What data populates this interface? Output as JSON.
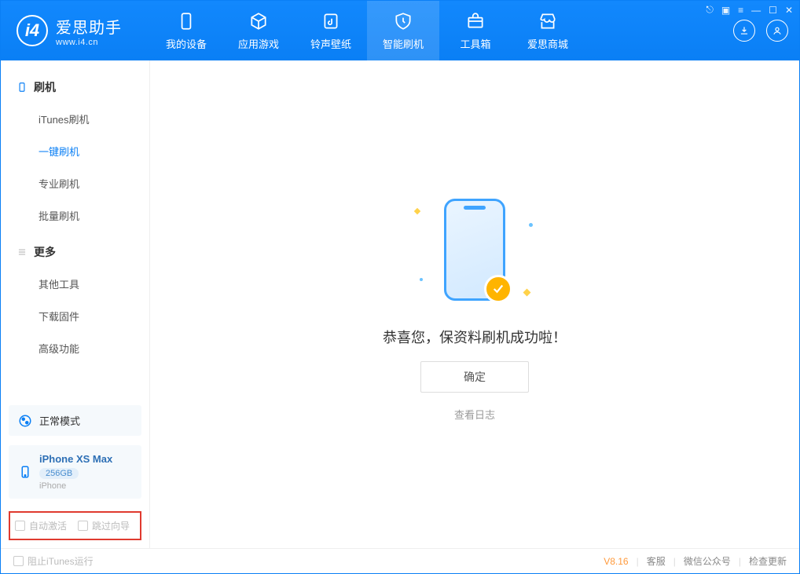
{
  "app": {
    "name_zh": "爱思助手",
    "name_en": "www.i4.cn",
    "version": "V8.16"
  },
  "tabs": [
    {
      "label": "我的设备"
    },
    {
      "label": "应用游戏"
    },
    {
      "label": "铃声壁纸"
    },
    {
      "label": "智能刷机"
    },
    {
      "label": "工具箱"
    },
    {
      "label": "爱思商城"
    }
  ],
  "sidebar": {
    "group1_title": "刷机",
    "group1_items": [
      "iTunes刷机",
      "一键刷机",
      "专业刷机",
      "批量刷机"
    ],
    "group2_title": "更多",
    "group2_items": [
      "其他工具",
      "下载固件",
      "高级功能"
    ]
  },
  "device": {
    "mode": "正常模式",
    "name": "iPhone XS Max",
    "capacity": "256GB",
    "type": "iPhone"
  },
  "options": {
    "auto_activate": "自动激活",
    "skip_guide": "跳过向导"
  },
  "main": {
    "success_msg": "恭喜您，保资料刷机成功啦！",
    "ok_btn": "确定",
    "log_link": "查看日志"
  },
  "footer": {
    "block_itunes": "阻止iTunes运行",
    "links": [
      "客服",
      "微信公众号",
      "检查更新"
    ]
  }
}
